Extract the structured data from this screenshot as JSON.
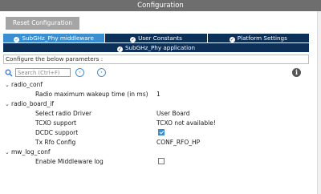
{
  "window": {
    "title": "Configuration"
  },
  "toolbar": {
    "reset_label": "Reset Configuration"
  },
  "tabs_row1": [
    {
      "label": "SubGHz_Phy middleware",
      "active": true
    },
    {
      "label": "User Constants",
      "active": false
    },
    {
      "label": "Platform Settings",
      "active": false
    }
  ],
  "tabs_row2": [
    {
      "label": "SubGHz_Phy application",
      "active": false
    }
  ],
  "configure": {
    "text": "Configure the below parameters :"
  },
  "search": {
    "placeholder": "Search (Ctrl+F)"
  },
  "tree": {
    "radio_conf": {
      "label": "radio_conf",
      "params": [
        {
          "name": "Radio maximum wakeup time (in ms)",
          "value": "1"
        }
      ]
    },
    "radio_board_if": {
      "label": "radio_board_if",
      "params": [
        {
          "name": "Select radio Driver",
          "value": "User Board"
        },
        {
          "name": "TCXO support",
          "value": "TCXO not available!"
        },
        {
          "name": "DCDC support",
          "checked": true
        },
        {
          "name": "Tx Rfo Config",
          "value": "CONF_RFO_HP"
        }
      ]
    },
    "mw_log_conf": {
      "label": "mw_log_conf",
      "params": [
        {
          "name": "Enable Middleware log",
          "checked": false
        }
      ]
    }
  },
  "colors": {
    "tab_bg": "#0d3058",
    "tab_active": "#3a8fd0",
    "titlebar": "#6e6e6e",
    "reset_button": "#a5a5a5"
  }
}
